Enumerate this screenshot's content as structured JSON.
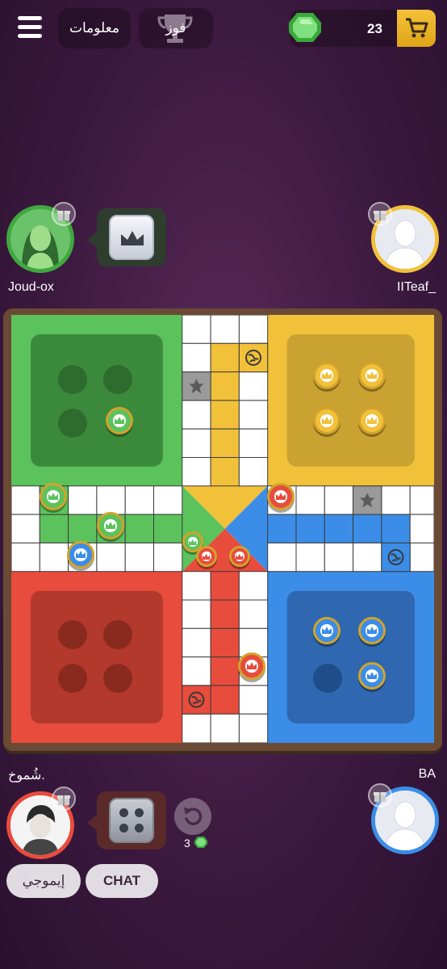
{
  "topbar": {
    "info_label": "معلومات",
    "win_label": "فوز",
    "gems_count": "23",
    "menu_icon": "hamburger-menu-icon",
    "trophy_icon": "trophy-icon",
    "cart_icon": "shopping-cart-icon",
    "gem_icon": "green-gem-icon"
  },
  "players": {
    "top_left": {
      "name": "Joud-ox",
      "color": "#3fa83f"
    },
    "top_right": {
      "name": "IITeaf_",
      "color": "#f2c13a"
    },
    "bottom_left": {
      "name": "شُموخ.",
      "color": "#e74c3c"
    },
    "bottom_right": {
      "name": "BA",
      "color": "#3b8de8"
    }
  },
  "controls": {
    "emoji_label": "إيموجي",
    "chat_label": "CHAT",
    "undo_count": "3"
  },
  "colors": {
    "green": "#5cc25c",
    "green_dark": "#3b8a3b",
    "yellow": "#f2c13a",
    "yellow_dark": "#c9a231",
    "red": "#e74c3c",
    "red_dark": "#b3392c",
    "blue": "#3b8de8",
    "blue_dark": "#2f68b0"
  }
}
